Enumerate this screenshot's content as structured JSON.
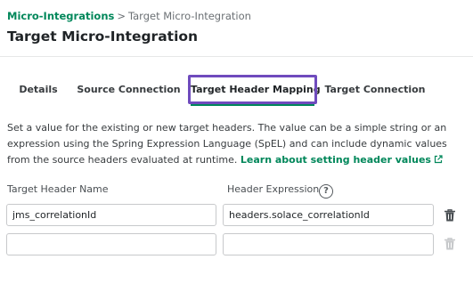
{
  "breadcrumb": {
    "parent": "Micro-Integrations",
    "separator": ">",
    "current": "Target Micro-Integration"
  },
  "page_title": "Target Micro-Integration",
  "tabs": [
    {
      "label": "Details",
      "active": false
    },
    {
      "label": "Source Connection",
      "active": false
    },
    {
      "label": "Target Header Mapping",
      "active": true
    },
    {
      "label": "Target Connection",
      "active": false
    }
  ],
  "description": {
    "text": "Set a value for the existing or new target headers. The value can be a simple string or an expression using the Spring Expression Language (SpEL) and can include dynamic values from the source headers evaluated at runtime.",
    "link_text": "Learn about setting header values",
    "link_icon": "external-link-icon"
  },
  "columns": {
    "name_label": "Target Header Name",
    "expression_label": "Header Expression",
    "help_icon": "help-circle-icon",
    "help_glyph": "?"
  },
  "rows": [
    {
      "name": "jms_correlationId",
      "expression": "headers.solace_correlationId",
      "delete_enabled": true
    },
    {
      "name": "",
      "expression": "",
      "delete_enabled": false
    }
  ],
  "colors": {
    "accent": "#00875a",
    "highlight_outline": "#6f4bbd",
    "icon_active": "#4a4f53",
    "icon_disabled": "#c7c9cb"
  }
}
